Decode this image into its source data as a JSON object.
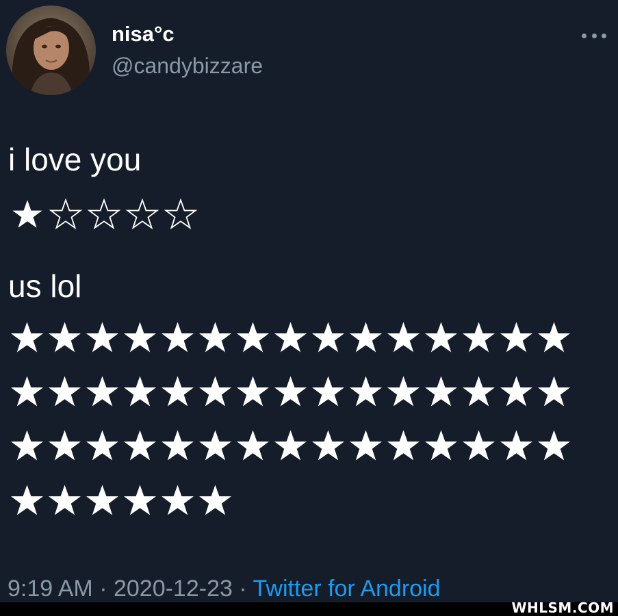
{
  "tweet": {
    "display_name": "nisa°c",
    "handle": "@candybizzare",
    "line1": "i love you",
    "rating1": {
      "filled": 1,
      "total": 5
    },
    "line2": "us lol",
    "rating2": {
      "rows": [
        15,
        15,
        15,
        6
      ]
    },
    "time": "9:19 AM",
    "separator1": " · ",
    "date": "2020-12-23",
    "separator2": " · ",
    "source": "Twitter for Android"
  },
  "watermark": "WHLSM.COM",
  "colors": {
    "background": "#151d2b",
    "text": "#ffffff",
    "muted": "#8b98a6",
    "link": "#1d9bf0"
  },
  "icons": {
    "more": "more-horizontal-icon",
    "star_filled": "star-filled-icon",
    "star_outline": "star-outline-icon"
  }
}
